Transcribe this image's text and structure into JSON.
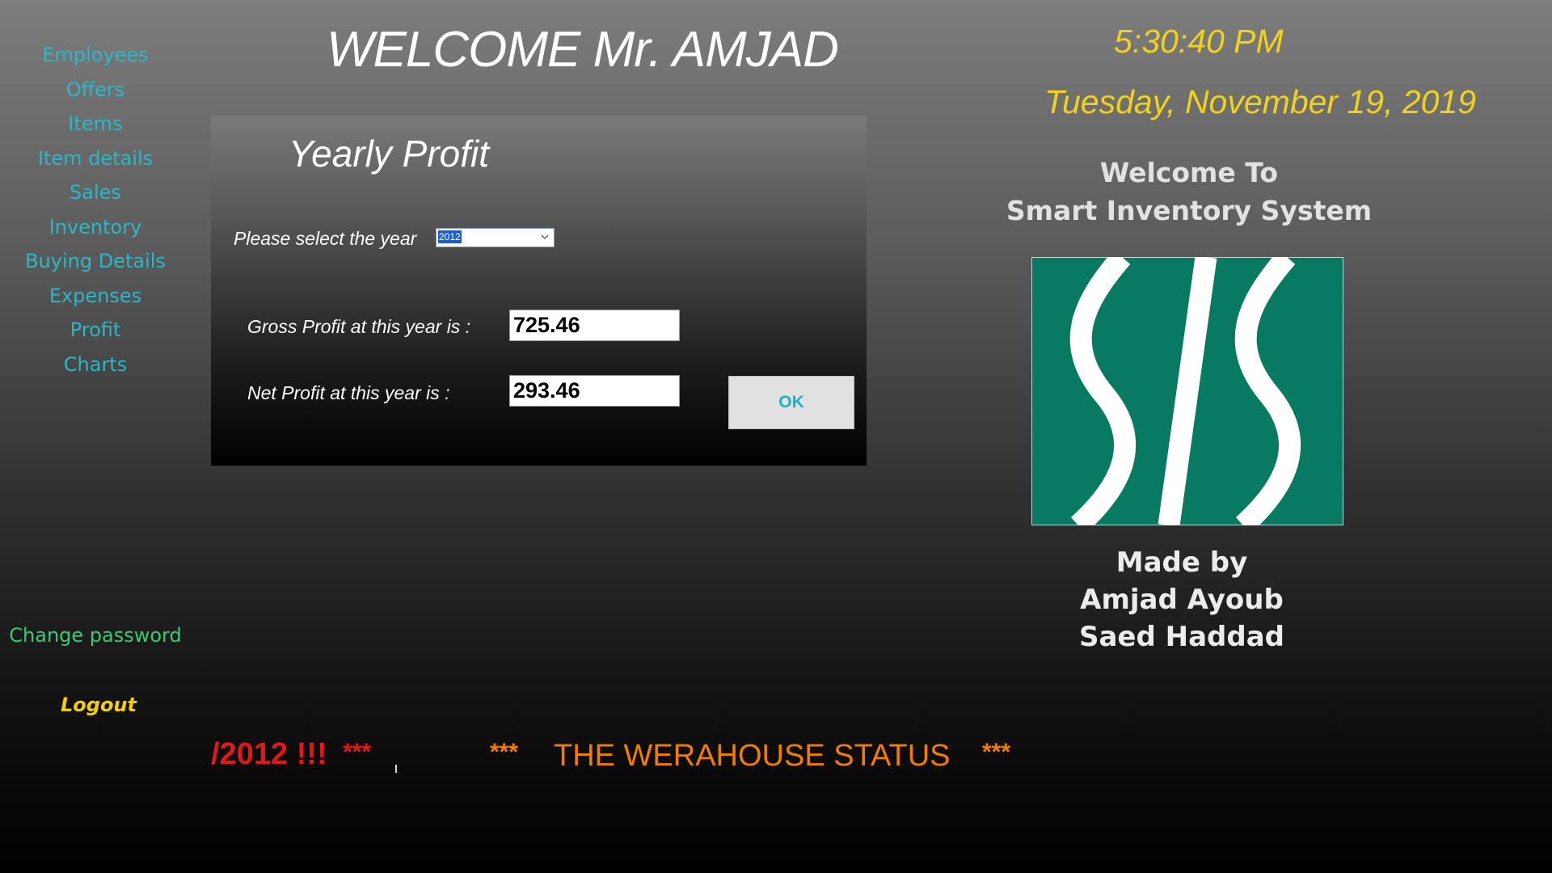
{
  "nav": {
    "items": [
      {
        "label": "Employees"
      },
      {
        "label": "Offers"
      },
      {
        "label": "Items"
      },
      {
        "label": "Item details"
      },
      {
        "label": "Sales"
      },
      {
        "label": "Inventory"
      },
      {
        "label": "Buying Details"
      },
      {
        "label": "Expenses"
      },
      {
        "label": "Profit"
      },
      {
        "label": "Charts"
      }
    ],
    "change_password": "Change password",
    "logout": "Logout",
    "link_color": "#2ab8c8"
  },
  "header": {
    "welcome": "WELCOME Mr. AMJAD",
    "time": "5:30:40 PM",
    "date": "Tuesday, November 19, 2019",
    "clock_color": "#f0d21c"
  },
  "panel": {
    "title": "Yearly Profit",
    "select_label": "Please select the year",
    "selected_year": "2012",
    "dropdown_icon": "chevron-down-icon",
    "gross_label": "Gross Profit at this year is :",
    "gross_value": "725.46",
    "net_label": "Net Profit at this year is :",
    "net_value": "293.46",
    "ok_label": "OK"
  },
  "info": {
    "welcome_to": "Welcome To",
    "system_name": "Smart Inventory System",
    "logo": "sis-logo",
    "logo_color": "#087a62",
    "made_by": "Made by",
    "authors": [
      "Amjad Ayoub",
      "Saed Haddad"
    ]
  },
  "marquee": {
    "alert_fragment": "/2012 !!!",
    "alert_stars": "***",
    "stars_left": "***",
    "status": "THE WERAHOUSE STATUS",
    "stars_right": "***",
    "alert_color": "#e01818",
    "status_color": "#f07c00"
  }
}
